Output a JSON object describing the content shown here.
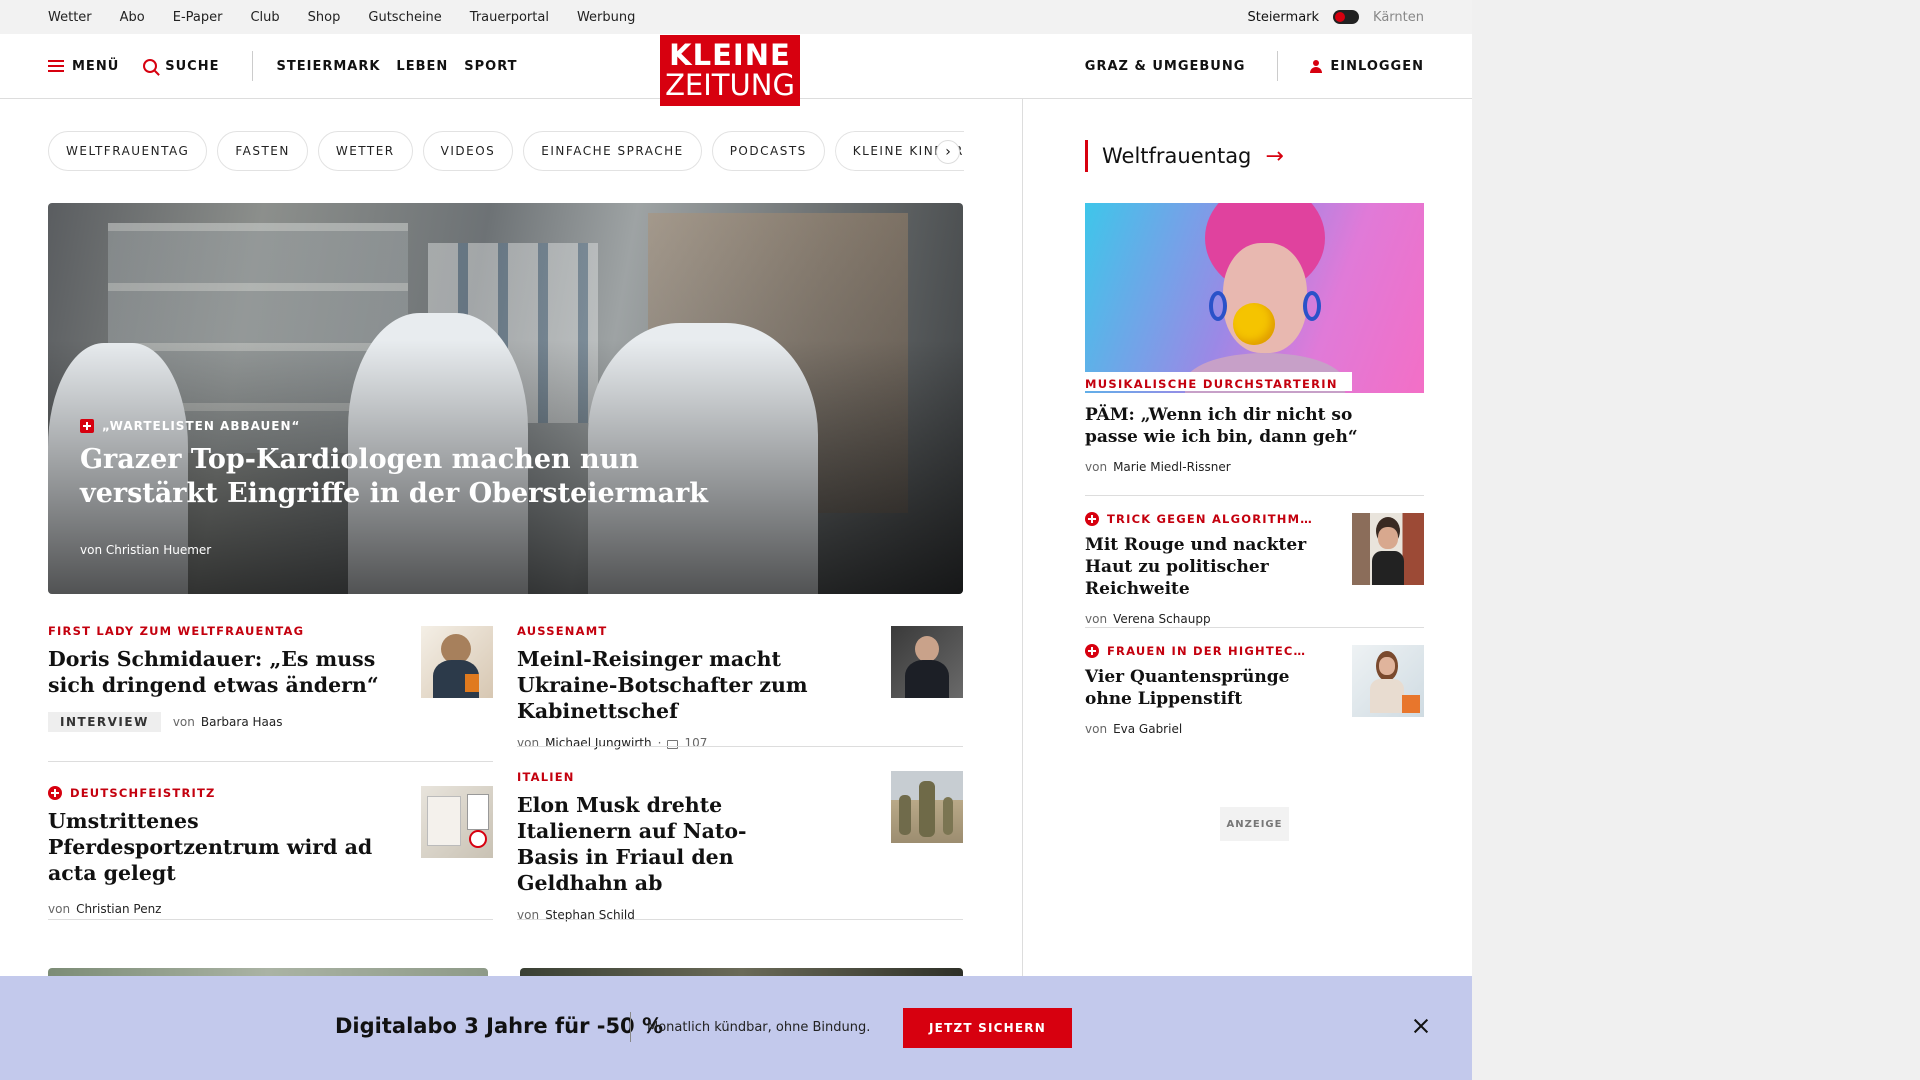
{
  "topbar": {
    "links": [
      "Wetter",
      "Abo",
      "E-Paper",
      "Club",
      "Shop",
      "Gutscheine",
      "Trauerportal",
      "Werbung"
    ],
    "region_active": "Steiermark",
    "region_inactive": "Kärnten"
  },
  "header": {
    "menu_label": "MENÜ",
    "search_label": "SUCHE",
    "nav": [
      "STEIERMARK",
      "LEBEN",
      "SPORT"
    ],
    "logo_line1": "KLEINE",
    "logo_line2": "ZEITUNG",
    "region_link": "GRAZ & UMGEBUNG",
    "login_label": "EINLOGGEN"
  },
  "chips": [
    "WELTFRAUENTAG",
    "FASTEN",
    "WETTER",
    "VIDEOS",
    "EINFACHE SPRACHE",
    "PODCASTS",
    "KLEINE KINDERZEITUNG"
  ],
  "chip_next_glyph": "›",
  "hero": {
    "kicker": "„WARTELISTEN ABBAUEN“",
    "title": "Grazer Top-Kardiologen machen nun verstärkt Eingriffe in der Obersteiermark",
    "by_prefix": "von",
    "author": "Christian Huemer"
  },
  "articles": [
    {
      "kicker": "FIRST LADY ZUM WELTFRAUENTAG",
      "title": "Doris Schmidauer: „Es muss sich dringend etwas ändern“",
      "tag": "INTERVIEW",
      "by_prefix": "von",
      "author": "Barbara Haas"
    },
    {
      "kicker": "AUSSENAMT",
      "title": "Meinl-Reisinger macht Ukraine-Botschafter zum Kabinettschef",
      "by_prefix": "von",
      "author": "Michael Jungwirth",
      "comments": "107"
    },
    {
      "kicker": "DEUTSCHFEISTRITZ",
      "title": "Umstrittenes Pferdesportzentrum wird ad acta gelegt",
      "by_prefix": "von",
      "author": "Christian Penz"
    },
    {
      "kicker": "ITALIEN",
      "title": "Elon Musk drehte Italienern auf Nato-Basis in Friaul den Geldhahn ab",
      "by_prefix": "von",
      "author": "Stephan Schild"
    }
  ],
  "sidebar": {
    "heading": "Weltfrauentag",
    "heading_arrow": "→",
    "items": [
      {
        "kicker": "MUSIKALISCHE DURCHSTARTERIN",
        "title": "PÄM: „Wenn ich dir nicht so passe wie ich bin, dann geh“",
        "by_prefix": "von",
        "author": "Marie Miedl-Rissner"
      },
      {
        "kicker": "TRICK GEGEN ALGORITHM…",
        "title": "Mit Rouge und nackter Haut zu politischer Reichweite",
        "by_prefix": "von",
        "author": "Verena Schaupp"
      },
      {
        "kicker": "FRAUEN IN DER HIGHTEC…",
        "title": "Vier Quantensprünge ohne Lippenstift",
        "by_prefix": "von",
        "author": "Eva Gabriel"
      }
    ],
    "ad_label": "ANZEIGE"
  },
  "banner": {
    "headline": "Digitalabo 3 Jahre für -50 %",
    "sub": "Monatlich kündbar, ohne Bindung.",
    "cta": "JETZT SICHERN"
  },
  "colors": {
    "brand_red": "#d7000f",
    "banner_bg": "#c3c9ec"
  }
}
